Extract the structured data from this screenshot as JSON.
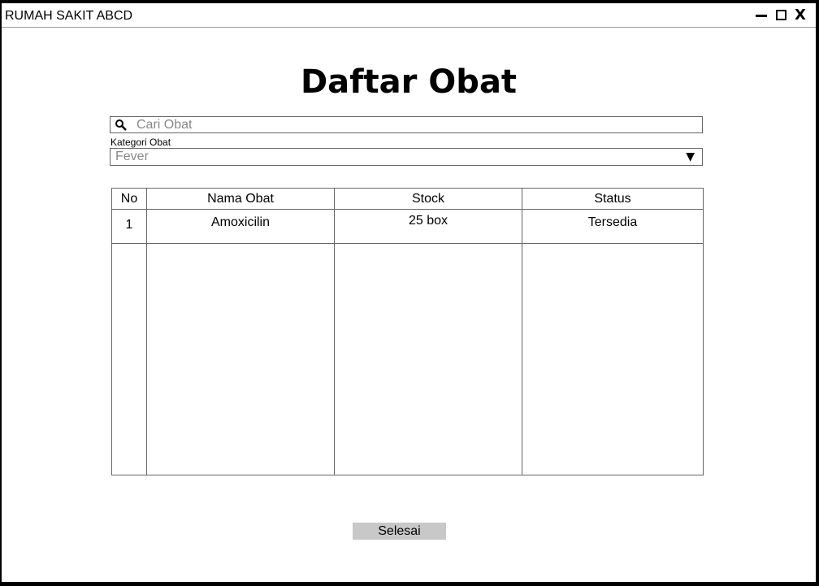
{
  "window": {
    "title": "RUMAH SAKIT ABCD",
    "controls": {
      "minimize": "—",
      "maximize": "☐",
      "close": "X"
    }
  },
  "page": {
    "title": "Daftar Obat"
  },
  "search": {
    "placeholder": "Cari Obat",
    "value": "",
    "icon": "search-icon"
  },
  "category": {
    "label": "Kategori Obat",
    "selected": "Fever",
    "arrow": "▼"
  },
  "table": {
    "columns": [
      "No",
      "Nama Obat",
      "Stock",
      "Status"
    ],
    "rows": [
      {
        "no": "1",
        "nama": "Amoxicilin",
        "stock": "25 box",
        "status": "Tersedia"
      }
    ]
  },
  "actions": {
    "done_label": "Selesai"
  }
}
